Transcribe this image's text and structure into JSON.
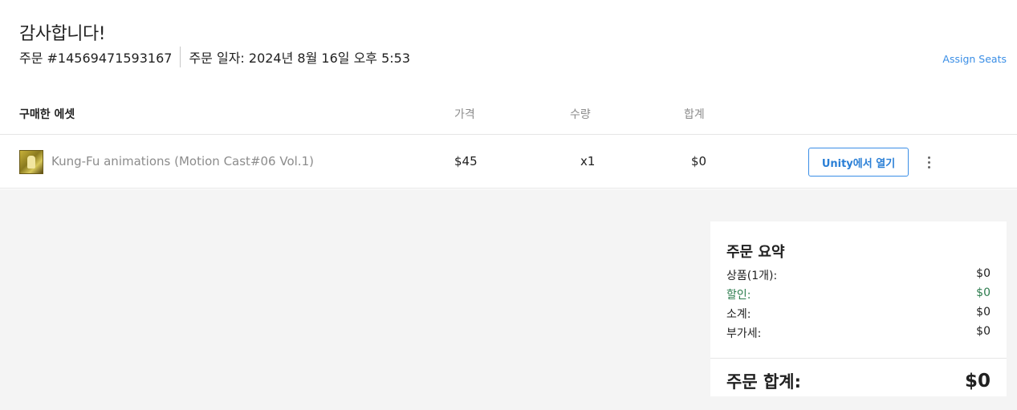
{
  "header": {
    "title": "감사합니다!",
    "order_number": "주문 #14569471593167",
    "order_date": "주문 일자: 2024년 8월 16일 오후 5:53",
    "assign_seats": "Assign Seats"
  },
  "table": {
    "columns": {
      "asset": "구매한 에셋",
      "price": "가격",
      "quantity": "수량",
      "total": "합계"
    },
    "rows": [
      {
        "name": "Kung-Fu animations (Motion Cast#06 Vol.1)",
        "price": "$45",
        "quantity": "x1",
        "total": "$0",
        "open_button": "Unity에서 열기"
      }
    ]
  },
  "summary": {
    "title": "주문 요약",
    "lines": [
      {
        "label": "상품(1개):",
        "value": "$0"
      },
      {
        "label": "할인:",
        "value": "$0"
      },
      {
        "label": "소계:",
        "value": "$0"
      },
      {
        "label": "부가세:",
        "value": "$0"
      }
    ],
    "total_label": "주문 합계:",
    "total_value": "$0"
  },
  "colors": {
    "accent": "#3a8ee6",
    "discount": "#2e7d4f",
    "background_grey": "#f4f4f4"
  },
  "icons": {
    "more_menu": "more-vertical-icon",
    "thumbnail": "asset-thumbnail"
  }
}
